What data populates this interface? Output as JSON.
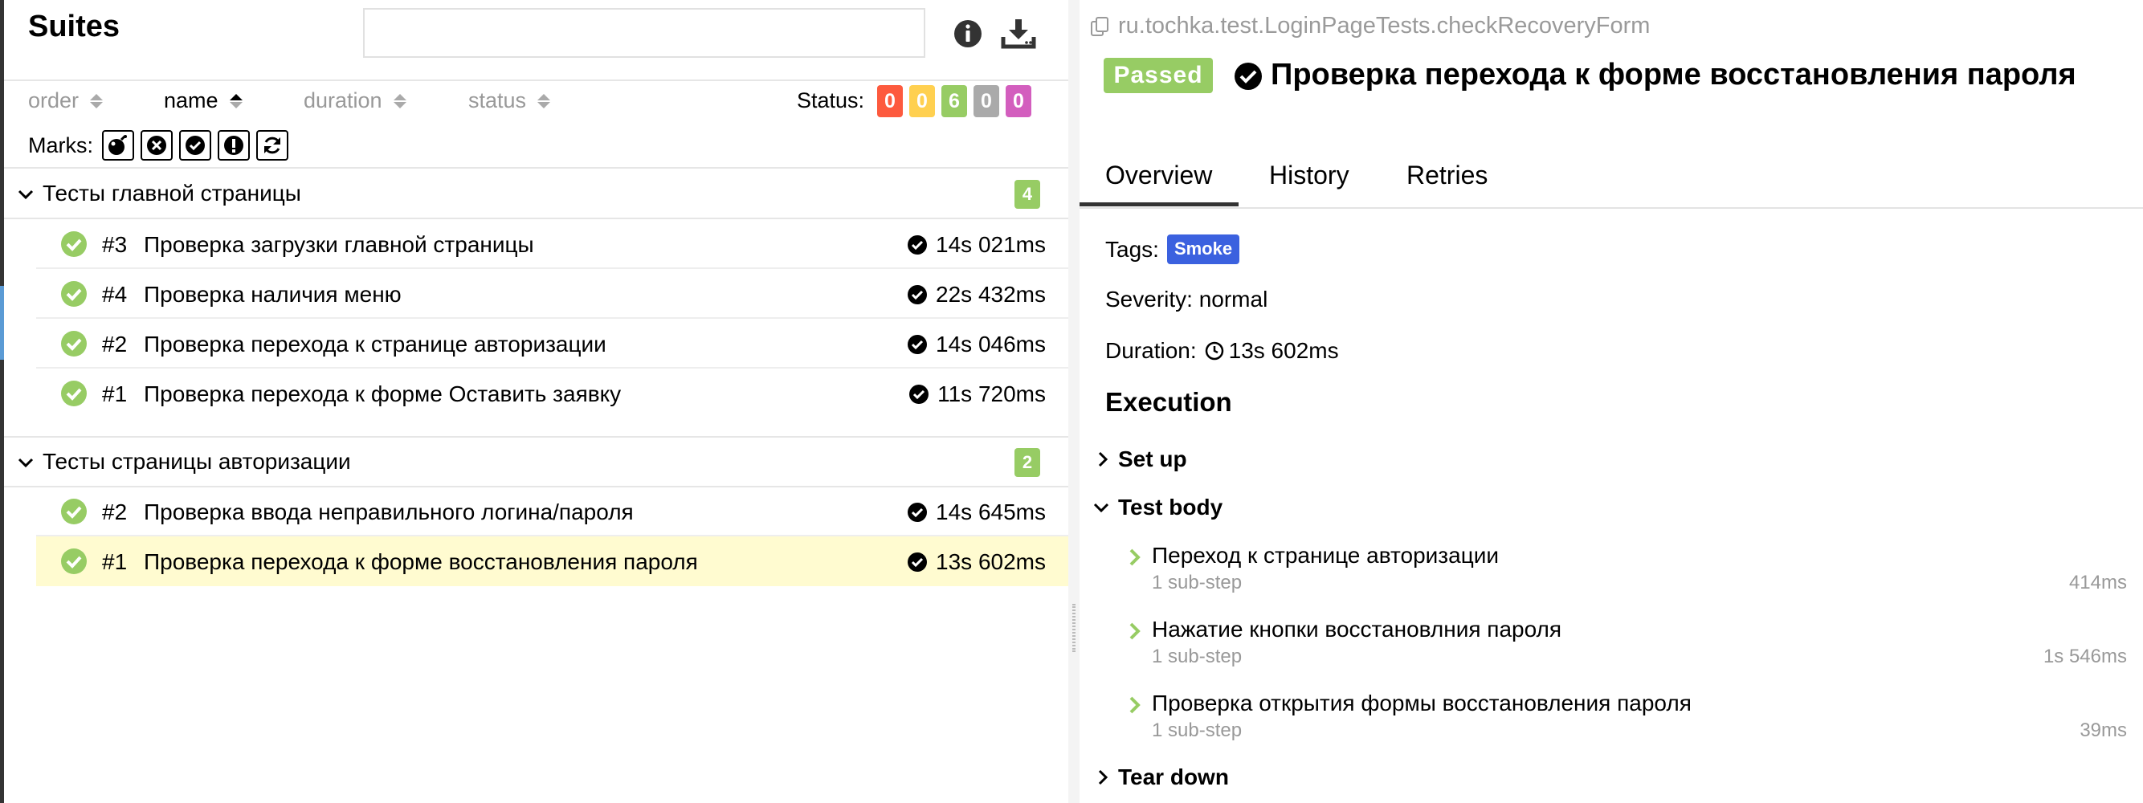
{
  "suites": {
    "title": "Suites",
    "search_placeholder": "",
    "icons": {
      "info": "info-icon",
      "download": "download-icon"
    },
    "sort": {
      "order": "order",
      "name": "name",
      "duration": "duration",
      "status": "status"
    },
    "status_label": "Status:",
    "status_counts": [
      {
        "value": "0",
        "color": "#fd5a3e",
        "status": "failed"
      },
      {
        "value": "0",
        "color": "#ffd050",
        "status": "broken"
      },
      {
        "value": "6",
        "color": "#97cc64",
        "status": "passed"
      },
      {
        "value": "0",
        "color": "#aaaaaa",
        "status": "skipped"
      },
      {
        "value": "0",
        "color": "#d35ebe",
        "status": "unknown"
      }
    ],
    "marks_label": "Marks:",
    "marks": [
      "flaky-icon",
      "new-failed-icon",
      "new-passed-icon",
      "new-broken-icon",
      "retries-icon"
    ],
    "groups": [
      {
        "name": "Тесты главной страницы",
        "count": "4",
        "items": [
          {
            "num": "#3",
            "title": "Проверка загрузки главной страницы",
            "duration": "14s 021ms"
          },
          {
            "num": "#4",
            "title": "Проверка наличия меню",
            "duration": "22s 432ms"
          },
          {
            "num": "#2",
            "title": "Проверка перехода к странице авторизации",
            "duration": "14s 046ms"
          },
          {
            "num": "#1",
            "title": "Проверка перехода к форме Оставить заявку",
            "duration": "11s 720ms"
          }
        ]
      },
      {
        "name": "Тесты страницы авторизации",
        "count": "2",
        "items": [
          {
            "num": "#2",
            "title": "Проверка ввода неправильного логина/пароля",
            "duration": "14s 645ms"
          },
          {
            "num": "#1",
            "title": "Проверка перехода к форме восстановления пароля",
            "duration": "13s 602ms"
          }
        ]
      }
    ]
  },
  "detail": {
    "full_name": "ru.tochka.test.LoginPageTests.checkRecoveryForm",
    "status": "Passed",
    "title": "Проверка перехода к форме восстановления пароля",
    "tabs": [
      "Overview",
      "History",
      "Retries"
    ],
    "tags_label": "Tags:",
    "tag": "Smoke",
    "severity": "Severity: normal",
    "duration_label": "Duration:",
    "duration": "13s 602ms",
    "execution_title": "Execution",
    "setup": "Set up",
    "test_body": "Test body",
    "steps": [
      {
        "name": "Переход к странице авторизации",
        "sub": "1 sub-step",
        "time": "414ms"
      },
      {
        "name": "Нажатие кнопки восстановлния пароля",
        "sub": "1 sub-step",
        "time": "1s 546ms"
      },
      {
        "name": "Проверка открытия формы восстановления пароля",
        "sub": "1 sub-step",
        "time": "39ms"
      }
    ],
    "teardown": "Tear down"
  }
}
